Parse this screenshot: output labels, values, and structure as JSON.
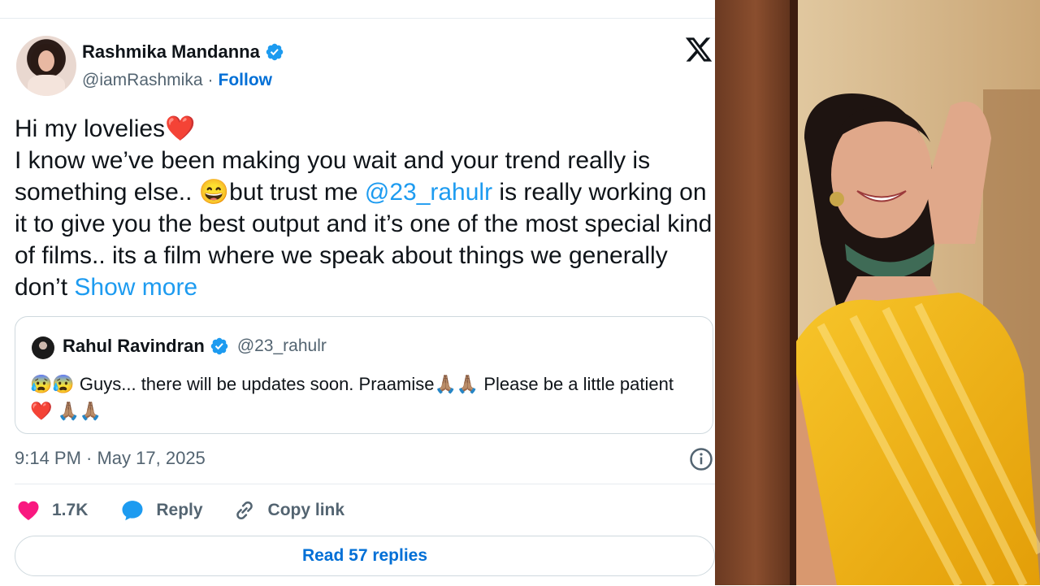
{
  "tweet": {
    "display_name": "Rashmika Mandanna",
    "handle": "@iamRashmika",
    "separator": "·",
    "follow_label": "Follow",
    "text_part1": "Hi my lovelies❤️\nI know we’ve been making you wait and your trend really is something else.. 😄but trust me ",
    "mention": "@23_rahulr",
    "text_part2": " is really working on it to give you the best output and it’s one of the most special kind of films.. its a film where we speak about things we generally don’t ",
    "show_more": "Show more",
    "timestamp": "9:14 PM · May 17, 2025"
  },
  "quote": {
    "display_name": "Rahul Ravindran",
    "handle": "@23_rahulr",
    "text": "😰😰 Guys... there will be updates soon. Praamise🙏🏽🙏🏽 Please be a little patient ❤️ 🙏🏽🙏🏽"
  },
  "actions": {
    "like_count": "1.7K",
    "reply_label": "Reply",
    "copy_label": "Copy link"
  },
  "read_replies_label": "Read 57 replies",
  "colors": {
    "accent": "#1d9bf0",
    "like": "#f91880",
    "secondary_text": "#536471",
    "saree_yellow": "#f2b705"
  },
  "icons": [
    "verified-badge-icon",
    "x-logo-icon",
    "info-icon",
    "heart-icon",
    "reply-bubble-icon",
    "link-icon"
  ]
}
